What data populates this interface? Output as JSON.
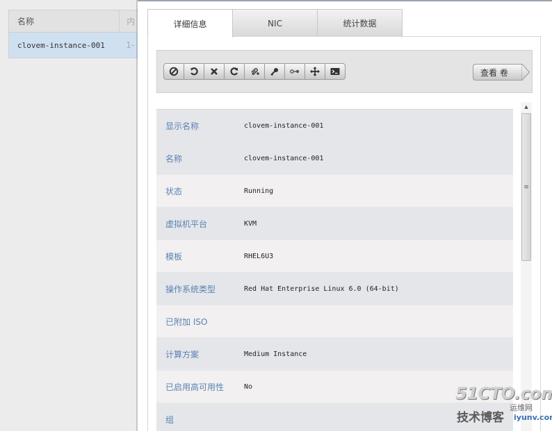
{
  "list": {
    "columns": [
      "名称",
      "内"
    ],
    "rows": [
      {
        "name": "clovem-instance-001",
        "col2": "1-"
      }
    ]
  },
  "tabs": [
    {
      "label": "详细信息",
      "active": true
    },
    {
      "label": "NIC",
      "active": false
    },
    {
      "label": "统计数据",
      "active": false
    }
  ],
  "toolbar": {
    "icons": [
      "stop-icon",
      "reboot-icon",
      "destroy-icon",
      "restore-icon",
      "attach-iso-icon",
      "reset-password-icon",
      "change-service-icon",
      "migrate-icon",
      "console-icon"
    ],
    "volume_label": "查看 卷"
  },
  "details": [
    {
      "label": "显示名称",
      "value": "clovem-instance-001"
    },
    {
      "label": "名称",
      "value": "clovem-instance-001"
    },
    {
      "label": "状态",
      "value": "Running"
    },
    {
      "label": "虚拟机平台",
      "value": "KVM"
    },
    {
      "label": "模板",
      "value": "RHEL6U3"
    },
    {
      "label": "操作系统类型",
      "value": "Red Hat Enterprise Linux 6.0 (64-bit)"
    },
    {
      "label": "已附加 ISO",
      "value": ""
    },
    {
      "label": "计算方案",
      "value": "Medium Instance"
    },
    {
      "label": "已启用高可用性",
      "value": "No"
    },
    {
      "label": "组",
      "value": ""
    }
  ],
  "watermark": {
    "top": "51CTO.com",
    "bottom": "技术博客",
    "side": "运维网",
    "url": "iyunv.com"
  },
  "colors": {
    "label_blue": "#5b82b3",
    "row_odd": "#e4e6ea",
    "row_even": "#f2f0f0",
    "selected_row": "#cfe0f1"
  }
}
